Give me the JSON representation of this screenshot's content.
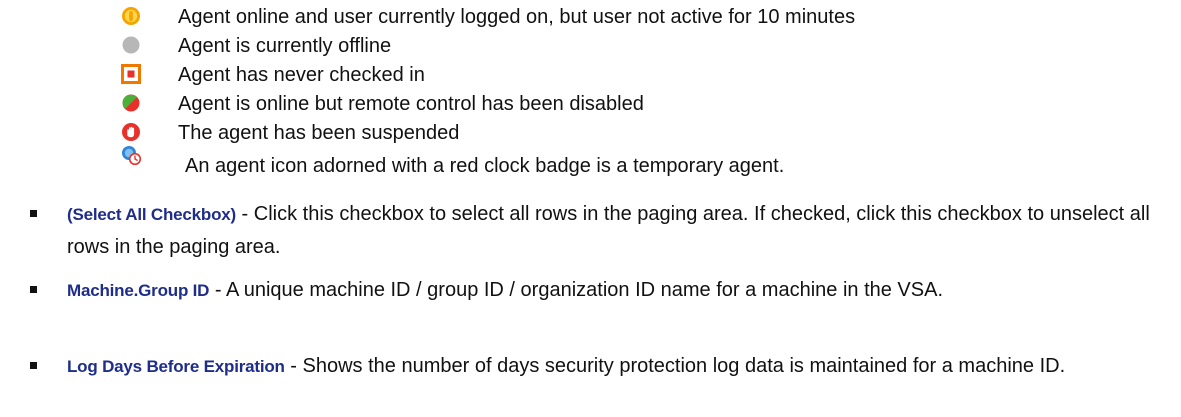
{
  "status_icons": [
    {
      "icon": "agent-online-user-idle-icon",
      "text": "Agent online and user currently logged on, but user not active for 10 minutes",
      "color": "#f5a300"
    },
    {
      "icon": "agent-offline-icon",
      "text": "Agent is currently offline",
      "color": "#b7b7b7"
    },
    {
      "icon": "agent-never-checked-in-icon",
      "text": "Agent has never checked in",
      "color": "#f07800"
    },
    {
      "icon": "agent-remote-control-disabled-icon",
      "text": "Agent is online but remote control has been disabled",
      "color": "#e8312a"
    },
    {
      "icon": "agent-suspended-icon",
      "text": "The agent has been suspended",
      "color": "#e8312a"
    },
    {
      "icon": "temporary-agent-icon",
      "text": "An agent icon adorned with a red clock badge is a temporary agent.",
      "color": "#2f86d8"
    }
  ],
  "bullets": [
    {
      "term": "(Select All Checkbox)",
      "separator": " - ",
      "description": "Click this checkbox to select all rows in the paging area. If checked, click this checkbox to unselect all rows in the paging area."
    },
    {
      "term": "Machine.Group ID",
      "separator": " - ",
      "description": "A unique machine ID / group ID / organization ID name for a machine in the VSA."
    },
    {
      "term": "Log Days Before Expiration",
      "separator": " - ",
      "description": "Shows the number of days security protection log data is maintained for a machine ID."
    }
  ],
  "colors": {
    "term_text": "#1f2d8a",
    "body_text": "#111111"
  }
}
